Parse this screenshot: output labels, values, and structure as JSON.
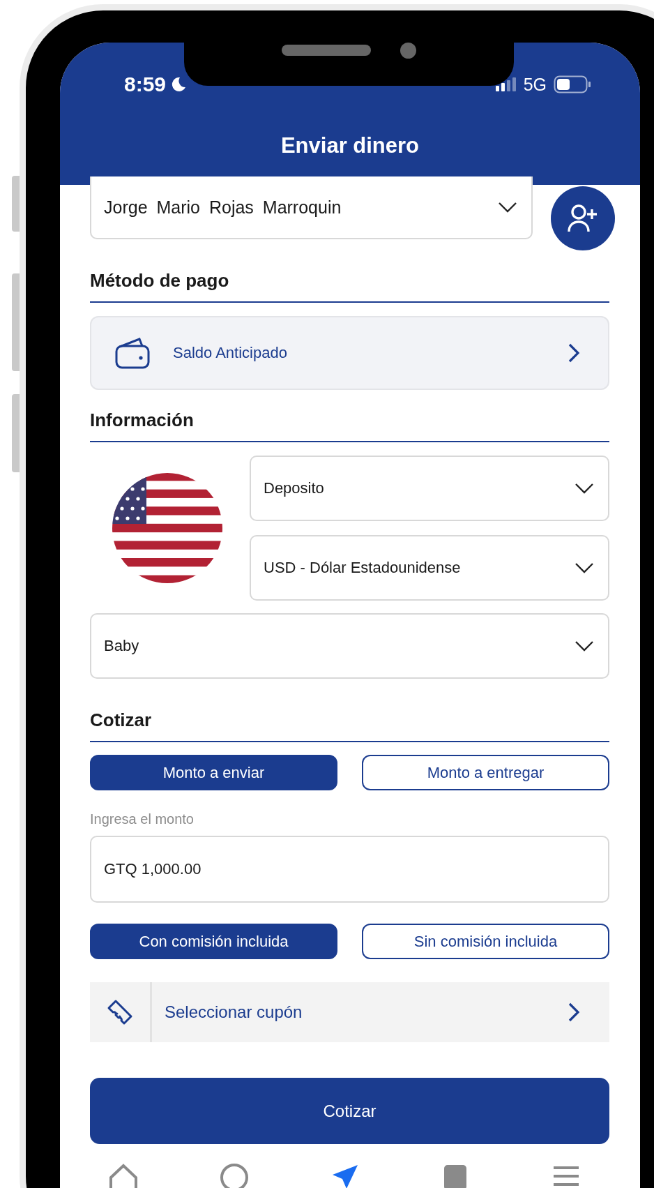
{
  "status_bar": {
    "time": "8:59",
    "network": "5G"
  },
  "header": {
    "title": "Enviar dinero"
  },
  "recipient": {
    "value": "Jorge Mario Rojas Marroquin"
  },
  "payment": {
    "heading": "Método de pago",
    "method": "Saldo Anticipado"
  },
  "info": {
    "heading": "Información",
    "selects": [
      {
        "value": "Deposito"
      },
      {
        "value": "USD - Dólar Estadounidense"
      }
    ],
    "bank": {
      "value": "Baby"
    }
  },
  "quote": {
    "heading": "Cotizar",
    "amount_modes": [
      {
        "label": "Monto a enviar",
        "selected": true
      },
      {
        "label": "Monto a entregar",
        "selected": false
      }
    ],
    "amount_label": "Ingresa el monto",
    "amount": {
      "value": "GTQ 1,000.00"
    },
    "commission_modes": [
      {
        "label": "Con comisión incluida",
        "selected": true
      },
      {
        "label": "Sin comisión incluida",
        "selected": false
      }
    ],
    "coupon": {
      "label": "Seleccionar cupón"
    },
    "submit": "Cotizar"
  },
  "tab_bar": {
    "items": [
      {
        "kind": "home",
        "selected": false
      },
      {
        "kind": "profile",
        "selected": false
      },
      {
        "kind": "send",
        "selected": true
      },
      {
        "kind": "document",
        "selected": false
      },
      {
        "kind": "menu",
        "selected": false
      }
    ]
  }
}
